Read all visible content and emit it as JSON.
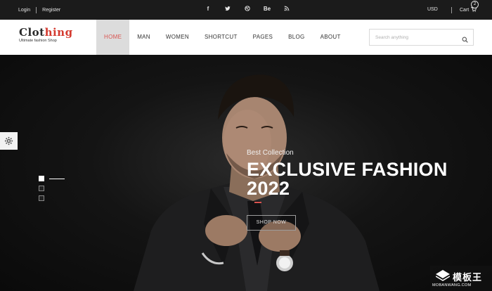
{
  "topbar": {
    "login": "Login",
    "register": "Register",
    "social": [
      "f",
      "t",
      "p",
      "Be",
      "rss"
    ],
    "currency": "USD",
    "cart_label": "Cart",
    "cart_count": "2"
  },
  "brand": {
    "name_main": "Clot",
    "name_accent": "hing",
    "tagline": "Ultimate fashion Shop"
  },
  "nav": {
    "items": [
      {
        "label": "HOME",
        "active": true
      },
      {
        "label": "MAN"
      },
      {
        "label": "WOMEN"
      },
      {
        "label": "SHORTCUT"
      },
      {
        "label": "PAGES"
      },
      {
        "label": "BLOG"
      },
      {
        "label": "ABOUT"
      }
    ]
  },
  "search": {
    "placeholder": "Search anything"
  },
  "hero": {
    "kicker": "Best Collection",
    "headline": "EXCLUSIVE FASHION 2022",
    "cta": "SHOP NOW",
    "active_slide": 1,
    "slide_count": 3
  },
  "watermark": {
    "title": "模板王",
    "site": "MOBANWANG.COM"
  },
  "colors": {
    "accent": "#d9534f",
    "topbar_bg": "#1b1b1b",
    "hero_bg": "#0e0e0e"
  }
}
